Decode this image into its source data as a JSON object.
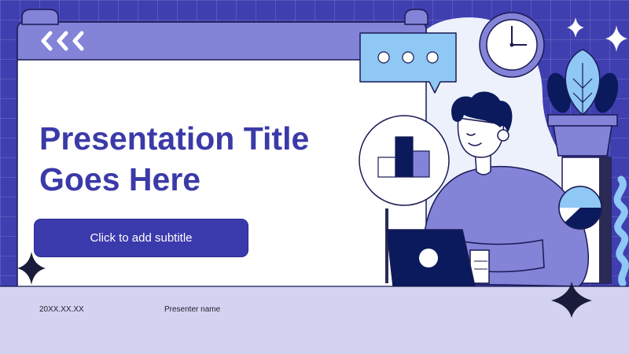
{
  "slide": {
    "title_line1": "Presentation Title",
    "title_line2": "Goes Here",
    "subtitle": "Click to add subtitle",
    "date": "20XX.XX.XX",
    "presenter": "Presenter name"
  },
  "colors": {
    "background": "#3f3fb0",
    "window_header": "#8383d8",
    "title": "#3b3aa8",
    "button": "#3b3aad",
    "footer": "#d3d3f1",
    "navy": "#0a1a5c",
    "light_blue": "#8fc7f5"
  },
  "icons": [
    "chevrons-left-icon",
    "chat-bubble-icon",
    "clock-icon",
    "bar-chart-icon",
    "pie-chart-icon",
    "plant-icon",
    "laptop-icon",
    "sparkle-icon",
    "squiggle-icon"
  ]
}
